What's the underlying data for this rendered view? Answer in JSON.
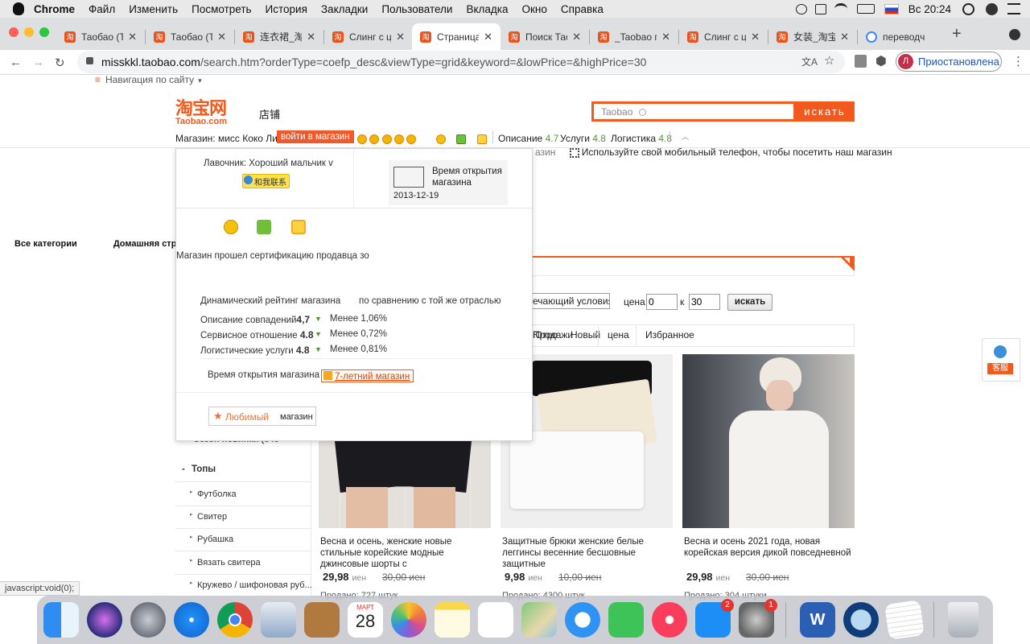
{
  "menubar": {
    "app": "Chrome",
    "items": [
      "Файл",
      "Изменить",
      "Посмотреть",
      "История",
      "Закладки",
      "Пользователи",
      "Вкладка",
      "Окно",
      "Справка"
    ],
    "clock": "Вс 20:24"
  },
  "tabs": [
    {
      "label": "Таобао (Т",
      "favicon": "taobao"
    },
    {
      "label": "Таобао (Т",
      "favicon": "taobao"
    },
    {
      "label": "连衣裙_淘宝",
      "favicon": "taobao"
    },
    {
      "label": "Слинг с ц",
      "favicon": "taobao"
    },
    {
      "label": "Страница",
      "favicon": "taobao",
      "active": true
    },
    {
      "label": "Поиск Тао",
      "favicon": "taobao"
    },
    {
      "label": "_Taobao по",
      "favicon": "taobao"
    },
    {
      "label": "Слинг с ц",
      "favicon": "taobao"
    },
    {
      "label": "女装_淘宝",
      "favicon": "taobao"
    },
    {
      "label": "переводч",
      "favicon": "google"
    }
  ],
  "toolbar": {
    "url_host": "misskkl.taobao.com",
    "url_rest": "/search.htm?orderType=coefp_desc&viewType=grid&keyword=&lowPrice=&highPrice=30",
    "profile_initial": "Л",
    "profile_status": "Приостановлена"
  },
  "site": {
    "nav": "Навигация по сайту",
    "logo_cn": "淘宝网",
    "logo_en": "Taobao.com",
    "shop_tab": "店铺",
    "search_placeholder": "Taobao",
    "search_button": "искать",
    "shop_name": "Магазин: мисс Коко Ли",
    "enter_shop": "войти в магазин",
    "rating_desc_label": "Описание",
    "rating_desc_value": "4.7",
    "rating_service_label": "Услуги",
    "rating_service_value": "4.8",
    "rating_logistics_label": "Логистика",
    "rating_logistics_value": "4.8",
    "mobile_hint_prefix": "азин",
    "mobile_hint": "Используйте свой мобильный телефон, чтобы посетить наш магазин",
    "cat_all": "Все категории",
    "cat_home": "Домашняя стр"
  },
  "popup": {
    "owner": "Лавочник: Хороший мальчик v",
    "contact": "和我联系",
    "open_time_label": "Время открытия магазина",
    "open_date": "2013-12-19",
    "cert_text": "Магазин прошел сертификацию продавца зо",
    "dyn_title": "Динамический рейтинг магазина",
    "dyn_compare": "по сравнению с той же отраслью",
    "r1_label": "Описание совпадений",
    "r1_value": "4,7",
    "r1_cmp": "Менее 1,06%",
    "r2_label": "Сервисное отношение",
    "r2_value": "4.8",
    "r2_cmp": "Менее 0,72%",
    "r3_label": "Логистические услуги",
    "r3_value": "4.8",
    "r3_cmp": "Менее 0,81%",
    "age_label": "Время открытия магазина",
    "age_value": "7-летний магазин",
    "fav_label": "Любимый",
    "fav_shop": "магазин"
  },
  "filter": {
    "match_label": "ечающий условиям.",
    "price_label": "цена:",
    "price_from": "0",
    "price_sep": "к",
    "price_to": "30",
    "go": "искать"
  },
  "sort": {
    "sales": "Продажи",
    "overlap": "Ютро",
    "new": "Новый",
    "price": "цена",
    "fav": "Избранное"
  },
  "service": {
    "label": "客服"
  },
  "tree": {
    "top_item": "Сезон новинки",
    "top_item_count": "(343",
    "group": "Топы",
    "items": [
      "Футболка",
      "Свитер",
      "Рубашка",
      "Вязать свитера",
      "Кружево / шифоновая руб..."
    ]
  },
  "products": [
    {
      "title": "Весна и осень, женские новые стильные корейские модные джинсовые шорты с",
      "price": "29,98",
      "old": "30,00",
      "cur": "иен",
      "sales": "Продано: 727 штук"
    },
    {
      "title": "Защитные брюки женские белые леггинсы весенние бесшовные защитные",
      "price": "9,98",
      "old": "10,00",
      "cur": "иен",
      "sales": "Продано: 4300 штук"
    },
    {
      "title": "Весна и осень 2021 года, новая корейская версия дикой повседневной",
      "price": "29,98",
      "old": "30,00",
      "cur": "иен",
      "sales": "Продано: 304 штуки"
    }
  ],
  "statusbar": {
    "text": "javascript:void(0);"
  },
  "dock": {
    "calendar_month": "МАРТ",
    "calendar_day": "28",
    "badge_appstore": "2",
    "badge_settings": "1"
  },
  "colors": {
    "taobao_orange": "#f25a1d",
    "rating_green": "#4a9b2e",
    "link_blue": "#1a56b8"
  }
}
